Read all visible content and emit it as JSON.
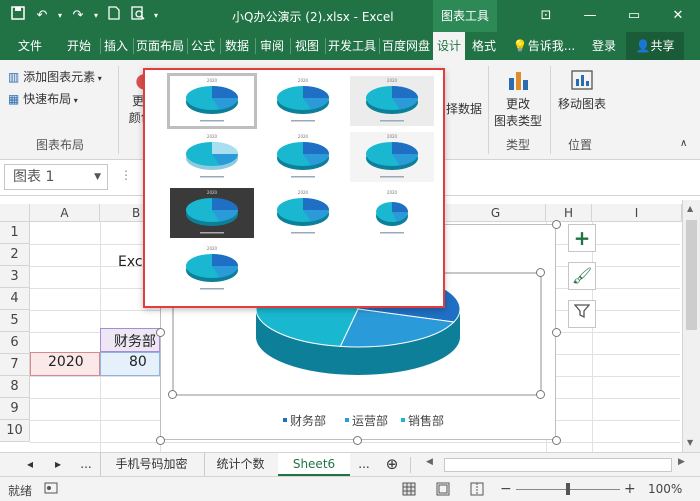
{
  "window": {
    "doc_title": "小Q办公演示 (2).xlsx - Excel",
    "tools_tab": "图表工具",
    "minimize": "—",
    "restore": "▭",
    "close": "✕",
    "ribbon_display": "⊡"
  },
  "tabs": [
    {
      "label": "文件"
    },
    {
      "label": "开始"
    },
    {
      "label": "插入"
    },
    {
      "label": "页面布局"
    },
    {
      "label": "公式"
    },
    {
      "label": "数据"
    },
    {
      "label": "审阅"
    },
    {
      "label": "视图"
    },
    {
      "label": "开发工具"
    },
    {
      "label": "百度网盘"
    },
    {
      "label": "设计"
    },
    {
      "label": "格式"
    }
  ],
  "tellme": "告诉我...",
  "login": "登录",
  "share": "共享",
  "ribbon": {
    "add_element": "添加图表元素",
    "quick_layout": "快速布局",
    "group_layout": "图表布局",
    "change_colors_1": "更改",
    "change_colors_2": "颜色",
    "select_data": "择数据",
    "change_type_1": "更改",
    "change_type_2": "图表类型",
    "group_type": "类型",
    "move_chart": "移动图表",
    "group_location": "位置"
  },
  "formula": {
    "namebox": "图表 1"
  },
  "columns": [
    "A",
    "B",
    "G",
    "H",
    "I"
  ],
  "rows": [
    "1",
    "2",
    "3",
    "4",
    "5",
    "6",
    "7",
    "8",
    "9",
    "10"
  ],
  "cells": {
    "b3": "Excel",
    "b6": "财务部",
    "a7": "2020",
    "b7": "80"
  },
  "gallery": {
    "thumb_title": "2020"
  },
  "chart_data": {
    "type": "pie",
    "categories": [
      "财务部",
      "运营部",
      "销售部"
    ],
    "colors": [
      "#1f6fc4",
      "#2a9bd8",
      "#19b8d0"
    ]
  },
  "sheets": {
    "prev": "◂",
    "next": "▸",
    "more_left": "...",
    "tab1": "手机号码加密",
    "tab2": "统计个数",
    "tab3": "Sheet6",
    "more_right": "...",
    "add": "⊕"
  },
  "status": {
    "ready": "就绪",
    "zoom": "100%",
    "minus": "−",
    "plus": "+"
  }
}
